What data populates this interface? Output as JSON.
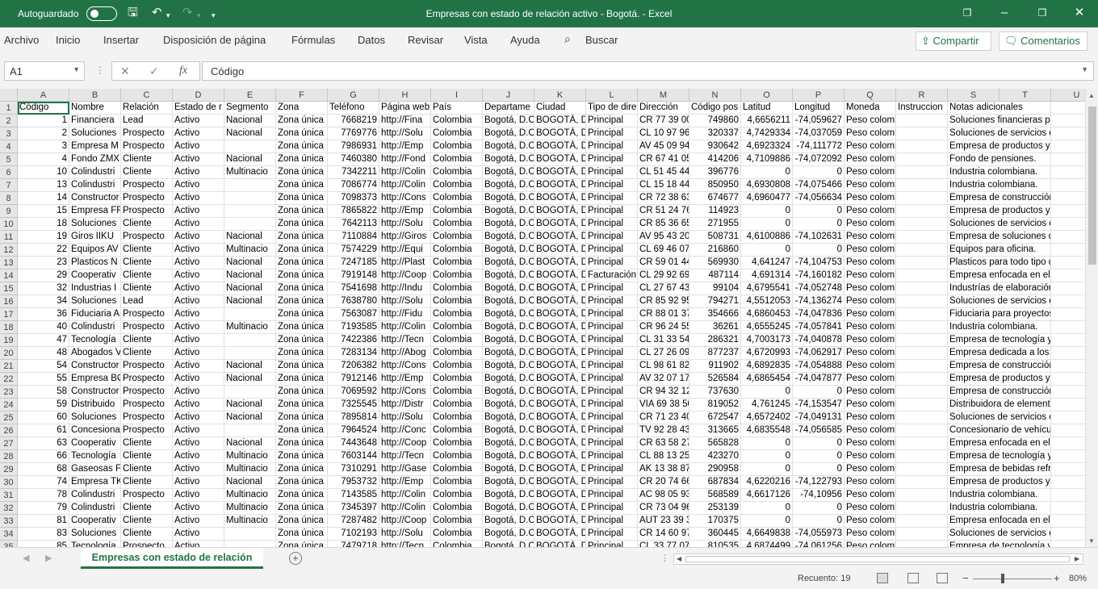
{
  "window": {
    "autosave_label": "Autoguardado",
    "title": "Empresas con estado de relación activo - Bogotá.  -  Excel"
  },
  "menu": {
    "items": [
      "Archivo",
      "Inicio",
      "Insertar",
      "Disposición de página",
      "Fórmulas",
      "Datos",
      "Revisar",
      "Vista",
      "Ayuda"
    ],
    "search_label": "Buscar",
    "share_label": "Compartir",
    "comments_label": "Comentarios"
  },
  "formula_bar": {
    "name_box": "A1",
    "fx": "fx",
    "value": "Código"
  },
  "sheet": {
    "column_letters": [
      "A",
      "B",
      "C",
      "D",
      "E",
      "F",
      "G",
      "H",
      "I",
      "J",
      "K",
      "L",
      "M",
      "N",
      "O",
      "P",
      "Q",
      "R",
      "S",
      "T",
      "U"
    ],
    "row_numbers": [
      "1",
      "2",
      "3",
      "4",
      "5",
      "6",
      "7",
      "8",
      "9",
      "10",
      "11",
      "12",
      "13",
      "14",
      "15",
      "16",
      "17",
      "18",
      "19",
      "20",
      "21",
      "22",
      "23",
      "24",
      "25",
      "26",
      "27",
      "28",
      "29",
      "30",
      "31",
      "32",
      "33",
      "34",
      "35"
    ],
    "headers": [
      "Código",
      "Nombre",
      "Relación",
      "Estado de r",
      "Segmento",
      "Zona",
      "Teléfono",
      "Página web",
      "País",
      "Departame",
      "Ciudad",
      "Tipo de dire",
      "Dirección",
      "Código pos",
      "Latitud",
      "Longitud",
      "Moneda",
      "Instruccion",
      "Notas adicionales",
      "",
      ""
    ],
    "rows": [
      [
        "1",
        "Financiera",
        "Lead",
        "Activo",
        "Nacional",
        "Zona única",
        "7668219",
        "http://Fina",
        "Colombia",
        "Bogotá, D.C",
        "BOGOTÁ, D.",
        "Principal",
        "CR  77 39 00",
        "749860",
        "4,6656211",
        "-74,059627",
        "Peso colombiano",
        "",
        "Soluciones financieras para a",
        "",
        ""
      ],
      [
        "2",
        "Soluciones",
        "Prospecto",
        "Activo",
        "Nacional",
        "Zona única",
        "7769776",
        "http://Solu",
        "Colombia",
        "Bogotá, D.C",
        "BOGOTÁ, D.",
        "Principal",
        "CL  10 97 96",
        "320337",
        "4,7429334",
        "-74,037059",
        "Peso colombiano",
        "",
        "Soluciones de servicios de ma",
        "",
        ""
      ],
      [
        "3",
        "Empresa M",
        "Prospecto",
        "Activo",
        "",
        "Zona única",
        "7986931",
        "http://Emp",
        "Colombia",
        "Bogotá, D.C",
        "BOGOTÁ, D.",
        "Principal",
        "AV  45 09 94",
        "930642",
        "4,6923324",
        "-74,111772",
        "Peso colombiano",
        "",
        "Empresa de productos y servic",
        "",
        ""
      ],
      [
        "4",
        "Fondo ZMX",
        "Cliente",
        "Activo",
        "Nacional",
        "Zona única",
        "7460380",
        "http://Fond",
        "Colombia",
        "Bogotá, D.C",
        "BOGOTÁ, D.",
        "Principal",
        "CR  67 41 05",
        "414206",
        "4,7109886",
        "-74,072092",
        "Peso colombiano",
        "",
        "Fondo de pensiones.",
        "",
        ""
      ],
      [
        "10",
        "Colindustri",
        "Cliente",
        "Activo",
        "Multinacio",
        "Zona única",
        "7342211",
        "http://Colin",
        "Colombia",
        "Bogotá, D.C",
        "BOGOTÁ, D.",
        "Principal",
        "CL  51 45 44",
        "396776",
        "0",
        "0",
        "Peso colombiano",
        "",
        "Industria colombiana.",
        "",
        ""
      ],
      [
        "13",
        "Colindustri",
        "Prospecto",
        "Activo",
        "",
        "Zona única",
        "7086774",
        "http://Colin",
        "Colombia",
        "Bogotá, D.C",
        "BOGOTÁ, D.",
        "Principal",
        "CL  15 18 44",
        "850950",
        "4,6930808",
        "-74,075466",
        "Peso colombiano",
        "",
        "Industria colombiana.",
        "",
        ""
      ],
      [
        "14",
        "Constructor",
        "Prospecto",
        "Activo",
        "",
        "Zona única",
        "7098373",
        "http://Cons",
        "Colombia",
        "Bogotá, D.C",
        "BOGOTÁ, D.",
        "Principal",
        "CR  72 38 63",
        "674677",
        "4,6960477",
        "-74,056634",
        "Peso colombiano",
        "",
        "Empresa de construcción de V",
        "",
        ""
      ],
      [
        "15",
        "Empresa FF",
        "Prospecto",
        "Activo",
        "",
        "Zona única",
        "7865822",
        "http://Emp",
        "Colombia",
        "Bogotá, D.C",
        "BOGOTÁ, D.",
        "Principal",
        "CR  51 24 76",
        "114923",
        "0",
        "0",
        "Peso colombiano",
        "",
        "Empresa de productos y servic",
        "",
        ""
      ],
      [
        "18",
        "Soluciones",
        "Cliente",
        "Activo",
        "",
        "Zona única",
        "7642113",
        "http://Solu",
        "Colombia",
        "Bogotá, D.C",
        "BOGOTÁ, D.",
        "Principal",
        "CR  85 36 65",
        "271955",
        "0",
        "0",
        "Peso colombiano",
        "",
        "Soluciones de servicios de ma",
        "",
        ""
      ],
      [
        "19",
        "Giros IIKU",
        "Prospecto",
        "Activo",
        "Nacional",
        "Zona única",
        "7110884",
        "http://Giros",
        "Colombia",
        "Bogotá, D.C",
        "BOGOTÁ, D.",
        "Principal",
        "AV  95 43 20",
        "508731",
        "4,6100886",
        "-74,102631",
        "Peso colombiano",
        "",
        "Empresa de soluciones de gir",
        "",
        ""
      ],
      [
        "22",
        "Equipos AV",
        "Cliente",
        "Activo",
        "Multinacio",
        "Zona única",
        "7574229",
        "http://Equi",
        "Colombia",
        "Bogotá, D.C",
        "BOGOTÁ, D.",
        "Principal",
        "CL  69 46 07",
        "216860",
        "0",
        "0",
        "Peso colombiano",
        "",
        "Equipos para oficina.",
        "",
        ""
      ],
      [
        "23",
        "Plasticos N",
        "Cliente",
        "Activo",
        "Nacional",
        "Zona única",
        "7247185",
        "http://Plast",
        "Colombia",
        "Bogotá, D.C",
        "BOGOTÁ, D.",
        "Principal",
        "CR  59 01 44",
        "569930",
        "4,641247",
        "-74,104753",
        "Peso colombiano",
        "",
        "Plasticos para todo tipo de in",
        "",
        ""
      ],
      [
        "29",
        "Cooperativ",
        "Cliente",
        "Activo",
        "Nacional",
        "Zona única",
        "7919148",
        "http://Coop",
        "Colombia",
        "Bogotá, D.C",
        "BOGOTÁ, D.",
        "Facturación",
        "CL  29 92 69",
        "487114",
        "4,691314",
        "-74,160182",
        "Peso colombiano",
        "",
        "Empresa enfocada en el bien",
        "",
        ""
      ],
      [
        "32",
        "Industrias I",
        "Cliente",
        "Activo",
        "Nacional",
        "Zona única",
        "7541698",
        "http://Indu",
        "Colombia",
        "Bogotá, D.C",
        "BOGOTÁ, D.",
        "Principal",
        "CL  27 67 43",
        "99104",
        "4,6795541",
        "-74,052748",
        "Peso colombiano",
        "",
        "Industrías de elaboración de",
        "",
        ""
      ],
      [
        "34",
        "Soluciones",
        "Lead",
        "Activo",
        "Nacional",
        "Zona única",
        "7638780",
        "http://Solu",
        "Colombia",
        "Bogotá, D.C",
        "BOGOTÁ, D.",
        "Principal",
        "CR  85 92 95",
        "794271",
        "4,5512053",
        "-74,136274",
        "Peso colombiano",
        "",
        "Soluciones de servicios de ma",
        "",
        ""
      ],
      [
        "36",
        "Fiduciaria A",
        "Prospecto",
        "Activo",
        "",
        "Zona única",
        "7563087",
        "http://Fidu",
        "Colombia",
        "Bogotá, D.C",
        "BOGOTÁ, D.",
        "Principal",
        "CR  88 01 37",
        "354666",
        "4,6860453",
        "-74,047836",
        "Peso colombiano",
        "",
        "Fiduciaria para proyectos de v",
        "",
        ""
      ],
      [
        "40",
        "Colindustri",
        "Prospecto",
        "Activo",
        "Multinacio",
        "Zona única",
        "7193585",
        "http://Colin",
        "Colombia",
        "Bogotá, D.C",
        "BOGOTÁ, D.",
        "Principal",
        "CR  96 24 55",
        "36261",
        "4,6555245",
        "-74,057841",
        "Peso colombiano",
        "",
        "Industria colombiana.",
        "",
        ""
      ],
      [
        "47",
        "Tecnología",
        "Cliente",
        "Activo",
        "",
        "Zona única",
        "7422386",
        "http://Tecn",
        "Colombia",
        "Bogotá, D.C",
        "BOGOTÁ, D.",
        "Principal",
        "CL  31 33 54",
        "286321",
        "4,7003173",
        "-74,040878",
        "Peso colombiano",
        "",
        "Empresa de tecnología y proye",
        "",
        ""
      ],
      [
        "48",
        "Abogados V",
        "Cliente",
        "Activo",
        "",
        "Zona única",
        "7283134",
        "http://Abog",
        "Colombia",
        "Bogotá, D.C",
        "BOGOTÁ, D.",
        "Principal",
        "CL  27 26 09",
        "877237",
        "4,6720993",
        "-74,062917",
        "Peso colombiano",
        "",
        "Empresa dedicada a los proce",
        "",
        ""
      ],
      [
        "54",
        "Constructor",
        "Prospecto",
        "Activo",
        "Nacional",
        "Zona única",
        "7206382",
        "http://Cons",
        "Colombia",
        "Bogotá, D.C",
        "BOGOTÁ, D.",
        "Principal",
        "CL  98 61 82",
        "911902",
        "4,6892835",
        "-74,054888",
        "Peso colombiano",
        "",
        "Empresa de construcción de V",
        "",
        ""
      ],
      [
        "55",
        "Empresa BC",
        "Prospecto",
        "Activo",
        "Nacional",
        "Zona única",
        "7912146",
        "http://Emp",
        "Colombia",
        "Bogotá, D.C",
        "BOGOTÁ, D.",
        "Principal",
        "AV  32 07 17",
        "526584",
        "4,6865454",
        "-74,047877",
        "Peso colombiano",
        "",
        "Empresa de productos y servic",
        "",
        ""
      ],
      [
        "58",
        "Constructor",
        "Prospecto",
        "Activo",
        "",
        "Zona única",
        "7069592",
        "http://Cons",
        "Colombia",
        "Bogotá, D.C",
        "BOGOTÁ, D.",
        "Principal",
        "CR  94 32 12",
        "737630",
        "0",
        "0",
        "Peso colombiano",
        "",
        "Empresa de construcción de V",
        "",
        ""
      ],
      [
        "59",
        "Distribuido",
        "Prospecto",
        "Activo",
        "Nacional",
        "Zona única",
        "7325545",
        "http://Distr",
        "Colombia",
        "Bogotá, D.C",
        "BOGOTÁ, D.",
        "Principal",
        "VIA  69 38 50",
        "819052",
        "4,761245",
        "-74,153547",
        "Peso colombiano",
        "",
        "Distribuidora de elementos p",
        "",
        ""
      ],
      [
        "60",
        "Soluciones",
        "Prospecto",
        "Activo",
        "Nacional",
        "Zona única",
        "7895814",
        "http://Solu",
        "Colombia",
        "Bogotá, D.C",
        "BOGOTÁ, D.",
        "Principal",
        "CR  71 23 40",
        "672547",
        "4,6572402",
        "-74,049131",
        "Peso colombiano",
        "",
        "Soluciones de servicios de ma",
        "",
        ""
      ],
      [
        "61",
        "Concesiona",
        "Prospecto",
        "Activo",
        "",
        "Zona única",
        "7964524",
        "http://Conc",
        "Colombia",
        "Bogotá, D.C",
        "BOGOTÁ, D.",
        "Principal",
        "TV  92 28 43",
        "313665",
        "4,6835548",
        "-74,056585",
        "Peso colombiano",
        "",
        "Concesionario de vehículos fa",
        "",
        ""
      ],
      [
        "63",
        "Cooperativ",
        "Cliente",
        "Activo",
        "Nacional",
        "Zona única",
        "7443648",
        "http://Coop",
        "Colombia",
        "Bogotá, D.C",
        "BOGOTÁ, D.",
        "Principal",
        "CR  63 58 27",
        "565828",
        "0",
        "0",
        "Peso colombiano",
        "",
        "Empresa enfocada en el bien",
        "",
        ""
      ],
      [
        "66",
        "Tecnología",
        "Cliente",
        "Activo",
        "Multinacio",
        "Zona única",
        "7603144",
        "http://Tecn",
        "Colombia",
        "Bogotá, D.C",
        "BOGOTÁ, D.",
        "Principal",
        "CL  88 13 25",
        "423270",
        "0",
        "0",
        "Peso colombiano",
        "",
        "Empresa de tecnología y proye",
        "",
        ""
      ],
      [
        "68",
        "Gaseosas F",
        "Cliente",
        "Activo",
        "Multinacio",
        "Zona única",
        "7310291",
        "http://Gase",
        "Colombia",
        "Bogotá, D.C",
        "BOGOTÁ, D.",
        "Principal",
        "AK  13 38 87",
        "290958",
        "0",
        "0",
        "Peso colombiano",
        "",
        "Empresa de bebidas refrescan",
        "",
        ""
      ],
      [
        "74",
        "Empresa TK",
        "Cliente",
        "Activo",
        "Nacional",
        "Zona única",
        "7953732",
        "http://Emp",
        "Colombia",
        "Bogotá, D.C",
        "BOGOTÁ, D.",
        "Principal",
        "CR  20 74 66",
        "687834",
        "4,6220216",
        "-74,122793",
        "Peso colombiano",
        "",
        "Empresa de productos y servic",
        "",
        ""
      ],
      [
        "78",
        "Colindustri",
        "Prospecto",
        "Activo",
        "Multinacio",
        "Zona única",
        "7143585",
        "http://Colin",
        "Colombia",
        "Bogotá, D.C",
        "BOGOTÁ, D.",
        "Principal",
        "AC  98 05 93",
        "568589",
        "4,6617126",
        "-74,10956",
        "Peso colombiano",
        "",
        "Industria colombiana.",
        "",
        ""
      ],
      [
        "79",
        "Colindustri",
        "Cliente",
        "Activo",
        "Multinacio",
        "Zona única",
        "7345397",
        "http://Colin",
        "Colombia",
        "Bogotá, D.C",
        "BOGOTÁ, D.",
        "Principal",
        "CR  73 04 96",
        "253139",
        "0",
        "0",
        "Peso colombiano",
        "",
        "Industria colombiana.",
        "",
        ""
      ],
      [
        "81",
        "Cooperativ",
        "Cliente",
        "Activo",
        "Multinacio",
        "Zona única",
        "7287482",
        "http://Coop",
        "Colombia",
        "Bogotá, D.C",
        "BOGOTÁ, D.",
        "Principal",
        "AUT  23 39 3",
        "170375",
        "0",
        "0",
        "Peso colombiano",
        "",
        "Empresa enfocada en el bien",
        "",
        ""
      ],
      [
        "83",
        "Soluciones",
        "Cliente",
        "Activo",
        "",
        "Zona única",
        "7102193",
        "http://Solu",
        "Colombia",
        "Bogotá, D.C",
        "BOGOTÁ, D.",
        "Principal",
        "CR  14 60 97",
        "360445",
        "4,6649838",
        "-74,055973",
        "Peso colombiano",
        "",
        "Soluciones de servicios de ma",
        "",
        ""
      ],
      [
        "85",
        "Tecnología",
        "Prospecto",
        "Activo",
        "",
        "Zona única",
        "7479718",
        "http://Tecn",
        "Colombia",
        "Bogotá, D.C",
        "BOGOTÁ, D.",
        "Principal",
        "CL  33 77 07",
        "810535",
        "4,6874499",
        "-74,061256",
        "Peso colombiano",
        "",
        "Empresa de tecnología y proye",
        "",
        ""
      ]
    ]
  },
  "sheet_tab": {
    "name": "Empresas con estado de relación"
  },
  "status": {
    "count": "Recuento: 19",
    "zoom_minus": "−",
    "zoom_plus": "+",
    "zoom": "80%"
  }
}
